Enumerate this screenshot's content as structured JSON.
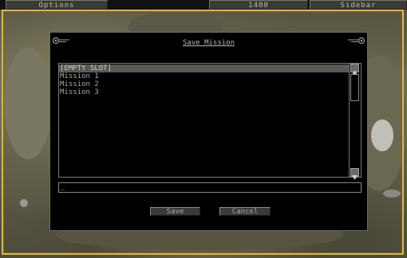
{
  "topbar": {
    "options_label": "Options",
    "credits_value": "1400",
    "sidebar_label": "Sidebar"
  },
  "dialog": {
    "title": "Save Mission",
    "slots": [
      {
        "label": "[EMPTY SLOT]",
        "selected": true
      },
      {
        "label": "Mission 1",
        "selected": false
      },
      {
        "label": "Mission 2",
        "selected": false
      },
      {
        "label": "Mission 3",
        "selected": false
      }
    ],
    "name_input_value": "_",
    "save_label": "Save",
    "cancel_label": "Cancel"
  },
  "colors": {
    "map_border": "#d8b64a",
    "dialog_bg": "#000000",
    "selected_row": "#585854"
  }
}
